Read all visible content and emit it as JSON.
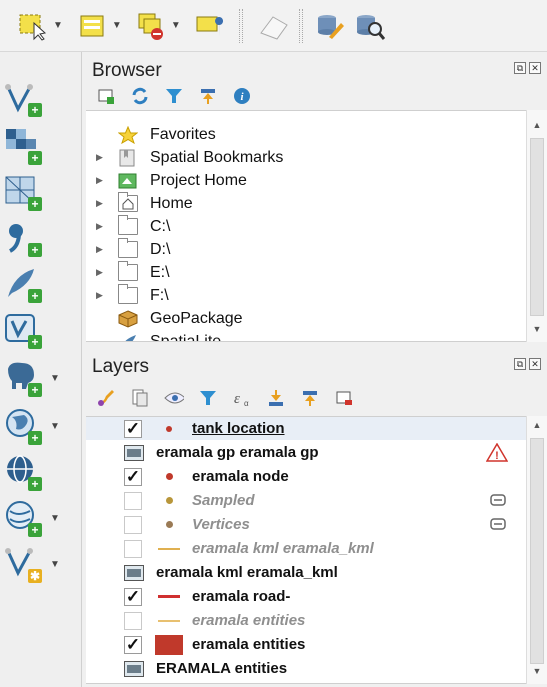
{
  "browser": {
    "title": "Browser",
    "items": [
      {
        "label": "Favorites",
        "expandable": false,
        "icon": "star-icon"
      },
      {
        "label": "Spatial Bookmarks",
        "expandable": true,
        "icon": "bookmark-icon"
      },
      {
        "label": "Project Home",
        "expandable": true,
        "icon": "project-home-icon"
      },
      {
        "label": "Home",
        "expandable": true,
        "icon": "home-icon"
      },
      {
        "label": "C:\\",
        "expandable": true,
        "icon": "folder-icon"
      },
      {
        "label": "D:\\",
        "expandable": true,
        "icon": "folder-icon"
      },
      {
        "label": "E:\\",
        "expandable": true,
        "icon": "folder-icon"
      },
      {
        "label": "F:\\",
        "expandable": true,
        "icon": "folder-icon"
      },
      {
        "label": "GeoPackage",
        "expandable": false,
        "icon": "geopackage-icon"
      },
      {
        "label": "SpatiaLite",
        "expandable": false,
        "icon": "spatialite-icon"
      }
    ]
  },
  "layers": {
    "title": "Layers",
    "items": [
      {
        "type": "layer",
        "label": "tank location",
        "checked": true,
        "symbol": "point",
        "color": "#c0392b",
        "dim": false,
        "underline": true
      },
      {
        "type": "group",
        "label": "eramala gp eramala gp",
        "warning": true
      },
      {
        "type": "layer",
        "label": "eramala node",
        "checked": true,
        "symbol": "point",
        "color": "#c0392b",
        "dim": false
      },
      {
        "type": "layer",
        "label": "Sampled",
        "checked": false,
        "symbol": "point",
        "color": "#b8963a",
        "dim": true,
        "filter": true
      },
      {
        "type": "layer",
        "label": "Vertices",
        "checked": false,
        "symbol": "point",
        "color": "#9a7a55",
        "dim": true,
        "filter": true
      },
      {
        "type": "layer",
        "label": "eramala kml eramala_kml",
        "checked": false,
        "symbol": "line",
        "color": "#e0b050",
        "dim": true
      },
      {
        "type": "group",
        "label": "eramala kml eramala_kml",
        "warning": false
      },
      {
        "type": "layer",
        "label": "eramala road-",
        "checked": true,
        "symbol": "line",
        "color": "#d03030",
        "dim": false
      },
      {
        "type": "layer",
        "label": "eramala  entities",
        "checked": false,
        "symbol": "line",
        "color": "#e8c070",
        "dim": true
      },
      {
        "type": "layer",
        "label": "eramala  entities",
        "checked": true,
        "symbol": "polygon",
        "color": "#c0392b",
        "dim": false
      },
      {
        "type": "group",
        "label": "ERAMALA  entities",
        "warning": false
      }
    ]
  },
  "colors": {
    "accent_green": "#3aa33a",
    "warning": "#d0342c"
  }
}
